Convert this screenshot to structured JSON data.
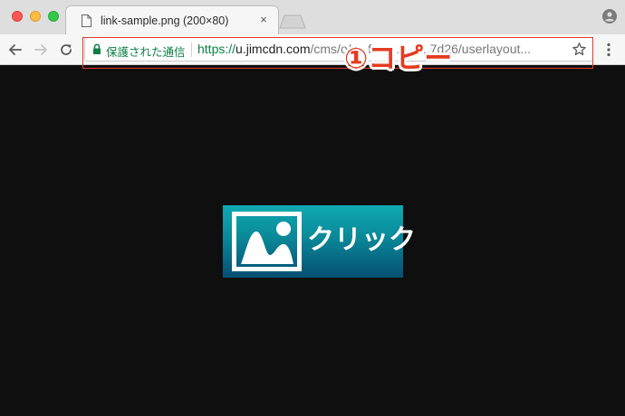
{
  "tab": {
    "title": "link-sample.png (200×80)",
    "close_glyph": "×",
    "doc_icon": "document-icon"
  },
  "toolbar": {
    "back_icon": "arrow-left-icon",
    "forward_icon": "arrow-right-icon",
    "reload_icon": "reload-icon",
    "menu_icon": "kebab-menu-icon"
  },
  "omnibox": {
    "secure_label": "保護された通信",
    "url_scheme": "https://",
    "url_host": "u.jimcdn.com",
    "url_path": "/cms/o/s...f...a...l...c...7d26/userlayout...",
    "lock_icon": "lock-icon",
    "star_icon": "star-icon"
  },
  "annotation": {
    "text": "①コピー",
    "color": "#e63a1f"
  },
  "content": {
    "link_label": "クリック",
    "image_icon": "image-icon"
  },
  "colors": {
    "secure_green": "#0b8043",
    "page_background": "#0f0f0f",
    "button_top": "#0fa9b2",
    "button_bottom": "#054f72"
  }
}
